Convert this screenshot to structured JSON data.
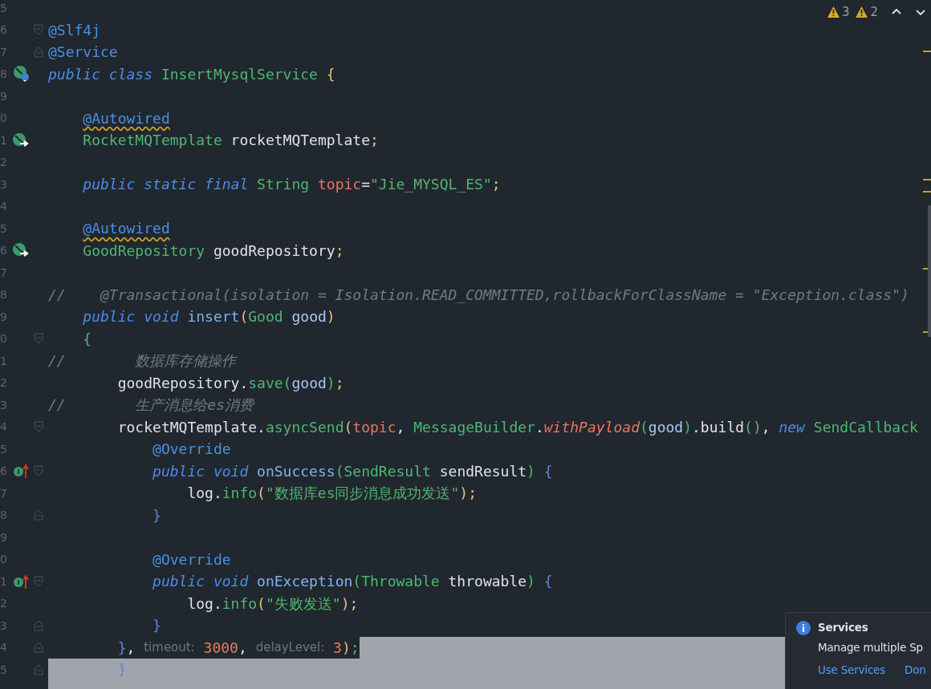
{
  "toolbar": {
    "problems": [
      {
        "kind": "warning",
        "count": "3"
      },
      {
        "kind": "weak_warning",
        "count": "2"
      }
    ],
    "nav": [
      {
        "kind": "up"
      },
      {
        "kind": "down"
      }
    ]
  },
  "lines": [
    {
      "number": "5"
    },
    {
      "number": "6",
      "fold": {
        "kind": "start"
      },
      "tokens": [
        {
          "text": "@Slf4j",
          "kind": "ann"
        }
      ]
    },
    {
      "number": "7",
      "fold": {
        "kind": "end"
      },
      "tokens": [
        {
          "text": "@Service",
          "kind": "ann"
        }
      ]
    },
    {
      "number": "8",
      "gutter": {
        "kind": "bean"
      },
      "tokens": [
        {
          "text": "public class ",
          "kind": "kw"
        },
        {
          "text": "InsertMysqlService ",
          "kind": "type"
        },
        {
          "text": "{",
          "kind": "b1"
        }
      ]
    },
    {
      "number": "9"
    },
    {
      "number": "0",
      "tokens": [
        {
          "text": "    @Autowired",
          "kind": "ann_warn"
        }
      ]
    },
    {
      "number": "1",
      "gutter": {
        "kind": "inject"
      },
      "tokens": [
        {
          "text": "    RocketMQTemplate ",
          "kind": "type"
        },
        {
          "text": "rocketMQTemplate",
          "kind": "plain"
        },
        {
          "text": ";",
          "kind": "semi"
        }
      ]
    },
    {
      "number": "2"
    },
    {
      "number": "3",
      "tokens": [
        {
          "text": "    public static final ",
          "kind": "kw"
        },
        {
          "text": "String ",
          "kind": "type"
        },
        {
          "text": "topic",
          "kind": "field"
        },
        {
          "text": "=",
          "kind": "plain"
        },
        {
          "text": "\"Jie_MYSQL_ES\"",
          "kind": "str"
        },
        {
          "text": ";",
          "kind": "semi"
        }
      ]
    },
    {
      "number": "4"
    },
    {
      "number": "5",
      "tokens": [
        {
          "text": "    @Autowired",
          "kind": "ann_warn"
        }
      ]
    },
    {
      "number": "6",
      "gutter": {
        "kind": "inject"
      },
      "tokens": [
        {
          "text": "    GoodRepository ",
          "kind": "type"
        },
        {
          "text": "goodRepository",
          "kind": "plain"
        },
        {
          "text": ";",
          "kind": "semi"
        }
      ]
    },
    {
      "number": "7"
    },
    {
      "number": "8",
      "tokens": [
        {
          "text": "//    @Transactional(isolation = Isolation.READ_COMMITTED,rollbackForClassName = \"Exception.class\")",
          "kind": "comment"
        }
      ]
    },
    {
      "number": "9",
      "tokens": [
        {
          "text": "    public void ",
          "kind": "kw"
        },
        {
          "text": "insert",
          "kind": "decl"
        },
        {
          "text": "(",
          "kind": "b1"
        },
        {
          "text": "Good ",
          "kind": "type"
        },
        {
          "text": "good",
          "kind": "param"
        },
        {
          "text": ")",
          "kind": "b1"
        }
      ]
    },
    {
      "number": "0",
      "fold": {
        "kind": "start"
      },
      "tokens": [
        {
          "text": "    {",
          "kind": "b2"
        }
      ]
    },
    {
      "number": "1",
      "tokens": [
        {
          "text": "//        数据库存储操作",
          "kind": "comment"
        }
      ]
    },
    {
      "number": "2",
      "tokens": [
        {
          "text": "        goodRepository.",
          "kind": "plain"
        },
        {
          "text": "save",
          "kind": "call"
        },
        {
          "text": "(",
          "kind": "b2"
        },
        {
          "text": "good",
          "kind": "param"
        },
        {
          "text": ")",
          "kind": "b2"
        },
        {
          "text": ";",
          "kind": "semi"
        }
      ]
    },
    {
      "number": "3",
      "tokens": [
        {
          "text": "//        生产消息给es消费",
          "kind": "comment"
        }
      ]
    },
    {
      "number": "4",
      "fold": {
        "kind": "start"
      },
      "tokens": [
        {
          "text": "        rocketMQTemplate.",
          "kind": "plain"
        },
        {
          "text": "asyncSend",
          "kind": "call"
        },
        {
          "text": "(",
          "kind": "b1"
        },
        {
          "text": "topic",
          "kind": "field"
        },
        {
          "text": ", ",
          "kind": "plain"
        },
        {
          "text": "MessageBuilder",
          "kind": "type"
        },
        {
          "text": ".",
          "kind": "plain"
        },
        {
          "text": "withPayload",
          "kind": "static"
        },
        {
          "text": "(",
          "kind": "b2"
        },
        {
          "text": "good",
          "kind": "param"
        },
        {
          "text": ")",
          "kind": "b2"
        },
        {
          "text": ".build",
          "kind": "plain"
        },
        {
          "text": "()",
          "kind": "b2"
        },
        {
          "text": ", ",
          "kind": "plain"
        },
        {
          "text": "new ",
          "kind": "kw"
        },
        {
          "text": "SendCallback",
          "kind": "type"
        }
      ]
    },
    {
      "number": "5",
      "tokens": [
        {
          "text": "            @Override",
          "kind": "ann"
        }
      ]
    },
    {
      "number": "6",
      "gutter": {
        "kind": "override"
      },
      "fold": {
        "kind": "start"
      },
      "tokens": [
        {
          "text": "            public void ",
          "kind": "kw"
        },
        {
          "text": "onSuccess",
          "kind": "decl"
        },
        {
          "text": "(",
          "kind": "b2"
        },
        {
          "text": "SendResult ",
          "kind": "type"
        },
        {
          "text": "sendResult",
          "kind": "plain"
        },
        {
          "text": ") ",
          "kind": "b2"
        },
        {
          "text": "{",
          "kind": "b3"
        }
      ]
    },
    {
      "number": "7",
      "tokens": [
        {
          "text": "                log.",
          "kind": "plain"
        },
        {
          "text": "info",
          "kind": "call"
        },
        {
          "text": "(",
          "kind": "b1"
        },
        {
          "text": "\"数据库es同步消息成功发送\"",
          "kind": "str"
        },
        {
          "text": ")",
          "kind": "b1"
        },
        {
          "text": ";",
          "kind": "semi"
        }
      ]
    },
    {
      "number": "8",
      "fold": {
        "kind": "end"
      },
      "tokens": [
        {
          "text": "            }",
          "kind": "b3"
        }
      ]
    },
    {
      "number": "9"
    },
    {
      "number": "0",
      "tokens": [
        {
          "text": "            @Override",
          "kind": "ann"
        }
      ]
    },
    {
      "number": "1",
      "gutter": {
        "kind": "override"
      },
      "fold": {
        "kind": "start"
      },
      "tokens": [
        {
          "text": "            public void ",
          "kind": "kw"
        },
        {
          "text": "onException",
          "kind": "decl"
        },
        {
          "text": "(",
          "kind": "b2"
        },
        {
          "text": "Throwable ",
          "kind": "type"
        },
        {
          "text": "throwable",
          "kind": "plain"
        },
        {
          "text": ") ",
          "kind": "b2"
        },
        {
          "text": "{",
          "kind": "b3"
        }
      ]
    },
    {
      "number": "2",
      "tokens": [
        {
          "text": "                log.",
          "kind": "plain"
        },
        {
          "text": "info",
          "kind": "call"
        },
        {
          "text": "(",
          "kind": "b1"
        },
        {
          "text": "\"失败发送\"",
          "kind": "str"
        },
        {
          "text": ")",
          "kind": "b1"
        },
        {
          "text": ";",
          "kind": "semi"
        }
      ]
    },
    {
      "number": "3",
      "fold": {
        "kind": "end"
      },
      "tokens": [
        {
          "text": "            }",
          "kind": "b3"
        }
      ]
    },
    {
      "number": "4",
      "selection": {
        "kind": "after_end"
      },
      "fold": {
        "kind": "end"
      },
      "tokens": [
        {
          "text": "        }",
          "kind": "b3"
        },
        {
          "text": ", ",
          "kind": "plain"
        },
        {
          "text": "timeout:",
          "kind": "hint"
        },
        {
          "text": " 3000",
          "kind": "num"
        },
        {
          "text": ", ",
          "kind": "plain"
        },
        {
          "text": "delayLevel:",
          "kind": "hint"
        },
        {
          "text": " 3",
          "kind": "num"
        },
        {
          "text": ")",
          "kind": "b1"
        },
        {
          "text": ";",
          "kind": "semi_end"
        }
      ]
    },
    {
      "number": "5",
      "selection": {
        "kind": "whole"
      },
      "fold": {
        "kind": "end"
      },
      "tokens": [
        {
          "text": "        }",
          "kind": "b3"
        }
      ]
    },
    {
      "selection": {
        "kind": "whole"
      }
    }
  ],
  "notification": {
    "title": "Services",
    "message": "Manage multiple Sp",
    "links": [
      "Use Services",
      "Don"
    ]
  }
}
